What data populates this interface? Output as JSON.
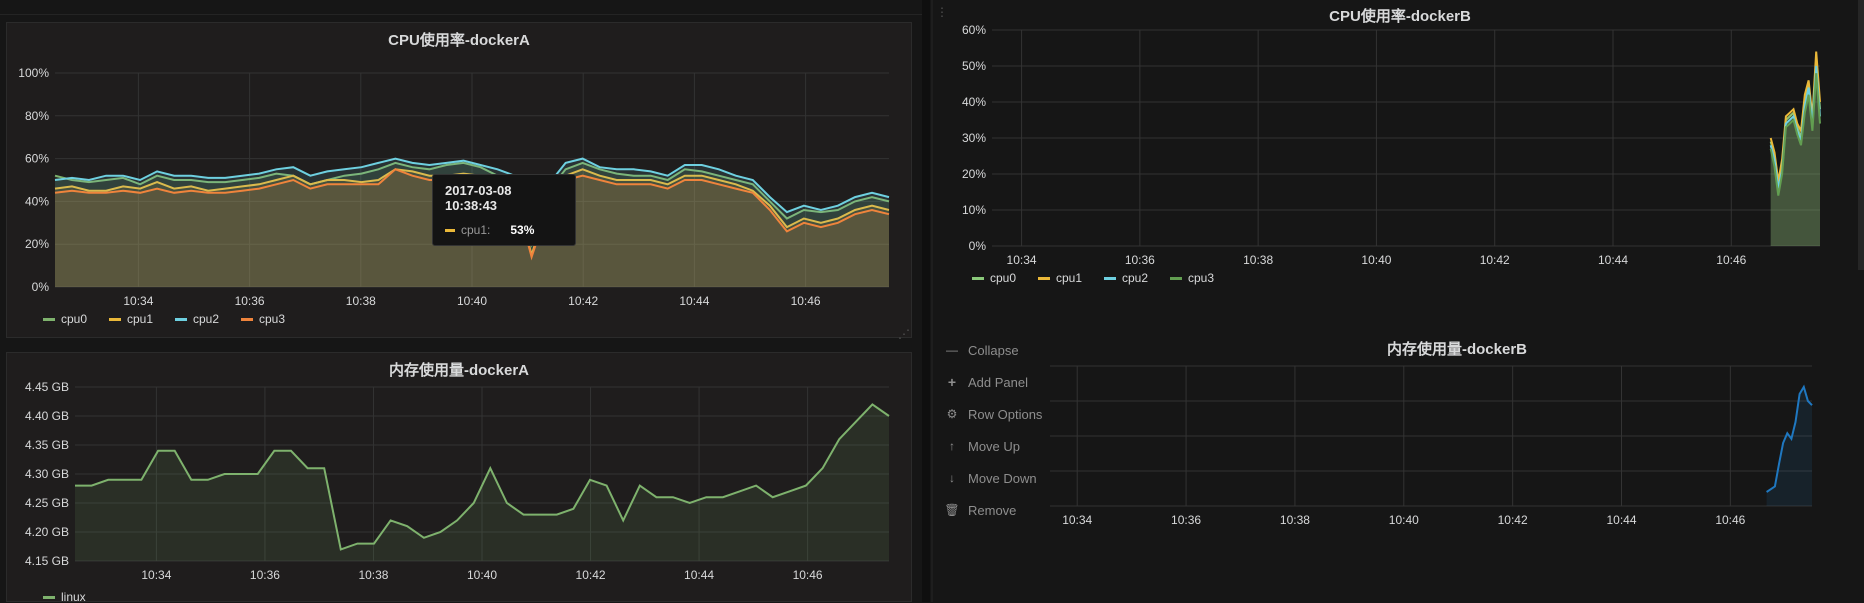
{
  "colors": {
    "cpu0": "#7eb26d",
    "cpu1": "#eab839",
    "cpu2": "#6ed0e0",
    "cpu3": "#ef843c",
    "cpu0_b": "#8ac97a",
    "cpu3_b": "#629e51",
    "linux": "#7eb26d",
    "memB": "#1f78c1",
    "grid": "#333333",
    "axisText": "#d8d9da"
  },
  "panels": {
    "cpuA": {
      "title": "CPU使用率-dockerA"
    },
    "memA": {
      "title": "内存使用量-dockerA"
    },
    "cpuB": {
      "title": "CPU使用率-dockerB"
    },
    "memB": {
      "title": "内存使用量-dockerB"
    }
  },
  "tooltip": {
    "time": "2017-03-08 10:38:43",
    "series": "cpu1:",
    "value": "53%"
  },
  "row_menu": [
    {
      "label": "Collapse",
      "icon": "minus-icon"
    },
    {
      "label": "Add Panel",
      "icon": "plus-icon"
    },
    {
      "label": "Row Options",
      "icon": "gear-icon"
    },
    {
      "label": "Move Up",
      "icon": "arrow-up-icon"
    },
    {
      "label": "Move Down",
      "icon": "arrow-down-icon"
    },
    {
      "label": "Remove",
      "icon": "trash-icon"
    }
  ],
  "chart_data": [
    {
      "id": "cpuA",
      "type": "area",
      "title": "CPU使用率-dockerA",
      "x_ticks": [
        "10:34",
        "10:36",
        "10:38",
        "10:40",
        "10:42",
        "10:44",
        "10:46"
      ],
      "x_range": [
        "10:32:30",
        "10:47:30"
      ],
      "y_ticks": [
        "0%",
        "20%",
        "40%",
        "60%",
        "80%",
        "100%"
      ],
      "ylim": [
        0,
        100
      ],
      "legend": [
        "cpu0",
        "cpu1",
        "cpu2",
        "cpu3"
      ],
      "legend_position": "bottom",
      "series": [
        {
          "name": "cpu0",
          "values": [
            52,
            50,
            49,
            50,
            51,
            48,
            52,
            50,
            50,
            49,
            49,
            50,
            51,
            53,
            52,
            48,
            50,
            52,
            53,
            55,
            58,
            56,
            55,
            57,
            58,
            56,
            52,
            50,
            20,
            45,
            55,
            58,
            55,
            53,
            52,
            52,
            50,
            55,
            54,
            52,
            50,
            48,
            40,
            32,
            36,
            35,
            36,
            40,
            42,
            40
          ]
        },
        {
          "name": "cpu1",
          "values": [
            46,
            47,
            45,
            45,
            47,
            46,
            49,
            46,
            47,
            45,
            46,
            47,
            48,
            50,
            52,
            48,
            50,
            50,
            49,
            50,
            55,
            54,
            52,
            52,
            53,
            52,
            48,
            46,
            15,
            40,
            52,
            55,
            52,
            50,
            50,
            50,
            48,
            52,
            52,
            50,
            48,
            45,
            38,
            28,
            32,
            30,
            32,
            36,
            38,
            36
          ]
        },
        {
          "name": "cpu2",
          "values": [
            50,
            51,
            50,
            52,
            52,
            50,
            54,
            52,
            52,
            51,
            51,
            52,
            53,
            55,
            56,
            52,
            54,
            55,
            56,
            58,
            60,
            58,
            57,
            58,
            59,
            57,
            55,
            52,
            22,
            48,
            58,
            60,
            56,
            55,
            55,
            54,
            52,
            57,
            57,
            55,
            52,
            50,
            42,
            35,
            38,
            36,
            38,
            42,
            44,
            42
          ]
        },
        {
          "name": "cpu3",
          "values": [
            44,
            45,
            44,
            44,
            45,
            44,
            46,
            44,
            45,
            44,
            44,
            45,
            46,
            48,
            50,
            46,
            48,
            48,
            48,
            48,
            55,
            52,
            50,
            50,
            52,
            50,
            46,
            44,
            14,
            38,
            50,
            52,
            50,
            48,
            48,
            48,
            46,
            50,
            50,
            48,
            46,
            44,
            36,
            26,
            30,
            28,
            30,
            34,
            36,
            34
          ]
        }
      ]
    },
    {
      "id": "memA",
      "type": "area",
      "title": "内存使用量-dockerA",
      "x_ticks": [
        "10:34",
        "10:36",
        "10:38",
        "10:40",
        "10:42",
        "10:44",
        "10:46"
      ],
      "x_range": [
        "10:32:30",
        "10:47:30"
      ],
      "y_ticks": [
        "4.15 GB",
        "4.20 GB",
        "4.25 GB",
        "4.30 GB",
        "4.35 GB",
        "4.40 GB",
        "4.45 GB"
      ],
      "ylim": [
        4.15,
        4.45
      ],
      "legend": [
        "linux"
      ],
      "legend_position": "bottom",
      "series": [
        {
          "name": "linux",
          "values": [
            4.28,
            4.28,
            4.29,
            4.29,
            4.29,
            4.34,
            4.34,
            4.29,
            4.29,
            4.3,
            4.3,
            4.3,
            4.34,
            4.34,
            4.31,
            4.31,
            4.17,
            4.18,
            4.18,
            4.22,
            4.21,
            4.19,
            4.2,
            4.22,
            4.25,
            4.31,
            4.25,
            4.23,
            4.23,
            4.23,
            4.24,
            4.29,
            4.28,
            4.22,
            4.28,
            4.26,
            4.26,
            4.25,
            4.26,
            4.26,
            4.27,
            4.28,
            4.26,
            4.27,
            4.28,
            4.31,
            4.36,
            4.39,
            4.42,
            4.4
          ]
        }
      ]
    },
    {
      "id": "cpuB",
      "type": "area",
      "title": "CPU使用率-dockerB",
      "x_ticks": [
        "10:34",
        "10:36",
        "10:38",
        "10:40",
        "10:42",
        "10:44",
        "10:46"
      ],
      "x_range": [
        "10:33:30",
        "10:47:30"
      ],
      "y_ticks": [
        "0%",
        "10%",
        "20%",
        "30%",
        "40%",
        "50%",
        "60%"
      ],
      "ylim": [
        0,
        60
      ],
      "legend": [
        "cpu0",
        "cpu1",
        "cpu2",
        "cpu3"
      ],
      "legend_position": "bottom",
      "series": [
        {
          "name": "cpu0",
          "x_start": "10:46:40",
          "values": [
            29,
            25,
            17,
            22,
            35,
            36,
            37,
            33,
            30,
            40,
            45,
            35,
            52,
            38
          ]
        },
        {
          "name": "cpu1",
          "x_start": "10:46:40",
          "values": [
            30,
            26,
            18,
            24,
            36,
            37,
            38,
            34,
            32,
            42,
            46,
            36,
            54,
            40
          ]
        },
        {
          "name": "cpu2",
          "x_start": "10:46:40",
          "values": [
            28,
            24,
            16,
            21,
            34,
            35,
            36,
            32,
            29,
            39,
            44,
            34,
            50,
            36
          ]
        },
        {
          "name": "cpu3",
          "x_start": "10:46:40",
          "values": [
            27,
            22,
            14,
            20,
            33,
            34,
            35,
            31,
            28,
            37,
            42,
            32,
            48,
            34
          ]
        }
      ]
    },
    {
      "id": "memB",
      "type": "area",
      "title": "内存使用量-dockerB",
      "x_ticks": [
        "10:34",
        "10:36",
        "10:38",
        "10:40",
        "10:42",
        "10:44",
        "10:46"
      ],
      "x_range": [
        "10:33:30",
        "10:47:30"
      ],
      "y_ticks": [],
      "legend": [],
      "series": [
        {
          "name": "",
          "x_start": "10:46:40",
          "values": [
            0.1,
            0.12,
            0.14,
            0.3,
            0.45,
            0.52,
            0.48,
            0.6,
            0.8,
            0.85,
            0.75,
            0.72
          ]
        }
      ]
    }
  ]
}
